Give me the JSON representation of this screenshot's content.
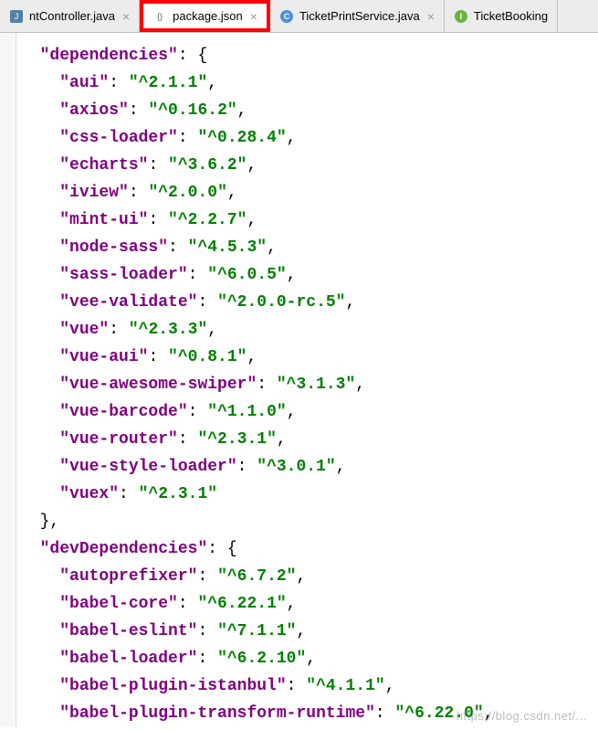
{
  "tabs": [
    {
      "label": "ntController.java",
      "iconType": "j",
      "iconText": "J",
      "closeable": true
    },
    {
      "label": "package.json",
      "iconType": "json",
      "iconText": "{}",
      "closeable": true,
      "highlighted": true
    },
    {
      "label": "TicketPrintService.java",
      "iconType": "c",
      "iconText": "C",
      "closeable": true
    },
    {
      "label": "TicketBooking",
      "iconType": "i",
      "iconText": "I",
      "closeable": false
    }
  ],
  "code": {
    "dependencies_key": "dependencies",
    "dependencies": [
      {
        "key": "aui",
        "value": "^2.1.1"
      },
      {
        "key": "axios",
        "value": "^0.16.2"
      },
      {
        "key": "css-loader",
        "value": "^0.28.4"
      },
      {
        "key": "echarts",
        "value": "^3.6.2"
      },
      {
        "key": "iview",
        "value": "^2.0.0"
      },
      {
        "key": "mint-ui",
        "value": "^2.2.7"
      },
      {
        "key": "node-sass",
        "value": "^4.5.3"
      },
      {
        "key": "sass-loader",
        "value": "^6.0.5"
      },
      {
        "key": "vee-validate",
        "value": "^2.0.0-rc.5"
      },
      {
        "key": "vue",
        "value": "^2.3.3"
      },
      {
        "key": "vue-aui",
        "value": "^0.8.1"
      },
      {
        "key": "vue-awesome-swiper",
        "value": "^3.1.3"
      },
      {
        "key": "vue-barcode",
        "value": "^1.1.0"
      },
      {
        "key": "vue-router",
        "value": "^2.3.1"
      },
      {
        "key": "vue-style-loader",
        "value": "^3.0.1"
      },
      {
        "key": "vuex",
        "value": "^2.3.1"
      }
    ],
    "devDependencies_key": "devDependencies",
    "devDependencies": [
      {
        "key": "autoprefixer",
        "value": "^6.7.2"
      },
      {
        "key": "babel-core",
        "value": "^6.22.1"
      },
      {
        "key": "babel-eslint",
        "value": "^7.1.1"
      },
      {
        "key": "babel-loader",
        "value": "^6.2.10"
      },
      {
        "key": "babel-plugin-istanbul",
        "value": "^4.1.1"
      },
      {
        "key": "babel-plugin-transform-runtime",
        "value": "^6.22.0"
      }
    ]
  },
  "watermark": "https://blog.csdn.net/..."
}
